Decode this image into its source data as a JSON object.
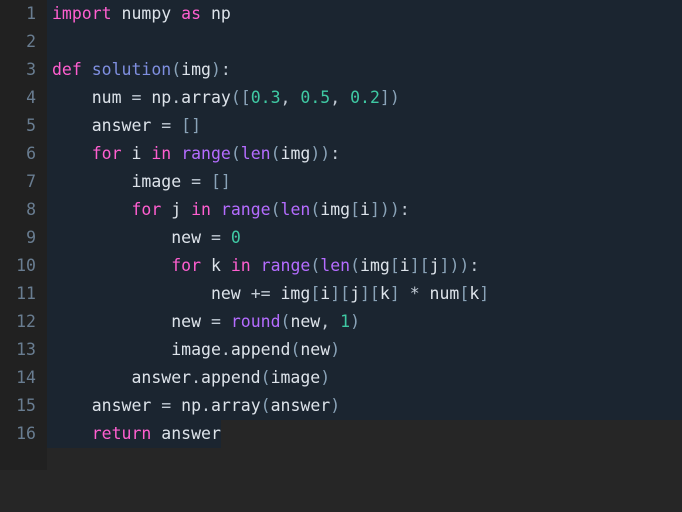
{
  "editor": {
    "language": "python",
    "total_lines": 16,
    "theme": {
      "page_background": "#262626",
      "gutter_background": "#212121",
      "code_background": "#1b2530",
      "line_number_color": "#697d91",
      "plain_text": "#dde3ea",
      "keyword": "#ff5fd0",
      "function_name": "#7f8fe0",
      "builtin": "#b56cff",
      "number": "#3fc9a3",
      "punctuation": "#8aa3b8",
      "operator": "#c3ccd6"
    }
  },
  "lines": [
    {
      "number": "1",
      "text": "import numpy as np"
    },
    {
      "number": "2",
      "text": ""
    },
    {
      "number": "3",
      "text": "def solution(img):"
    },
    {
      "number": "4",
      "text": "    num = np.array([0.3, 0.5, 0.2])"
    },
    {
      "number": "5",
      "text": "    answer = []"
    },
    {
      "number": "6",
      "text": "    for i in range(len(img)):"
    },
    {
      "number": "7",
      "text": "        image = []"
    },
    {
      "number": "8",
      "text": "        for j in range(len(img[i])):"
    },
    {
      "number": "9",
      "text": "            new = 0"
    },
    {
      "number": "10",
      "text": "            for k in range(len(img[i][j])):"
    },
    {
      "number": "11",
      "text": "                new += img[i][j][k] * num[k]"
    },
    {
      "number": "12",
      "text": "            new = round(new, 1)"
    },
    {
      "number": "13",
      "text": "            image.append(new)"
    },
    {
      "number": "14",
      "text": "        answer.append(image)"
    },
    {
      "number": "15",
      "text": "    answer = np.array(answer)"
    },
    {
      "number": "16",
      "text": "    return answer"
    }
  ],
  "code": {
    "full_source": "import numpy as np\n\ndef solution(img):\n    num = np.array([0.3, 0.5, 0.2])\n    answer = []\n    for i in range(len(img)):\n        image = []\n        for j in range(len(img[i])):\n            new = 0\n            for k in range(len(img[i][j])):\n                new += img[i][j][k] * num[k]\n            new = round(new, 1)\n            image.append(new)\n        answer.append(image)\n    answer = np.array(answer)\n    return answer"
  }
}
